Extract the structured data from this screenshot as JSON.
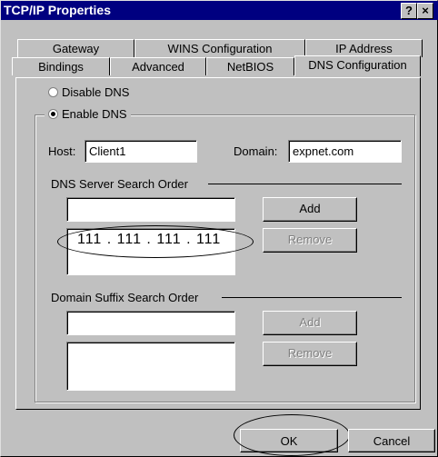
{
  "window": {
    "title": "TCP/IP Properties",
    "help_glyph": "?",
    "close_glyph": "×"
  },
  "tabs": {
    "back_row": [
      "Gateway",
      "WINS Configuration",
      "IP Address"
    ],
    "front_row": [
      "Bindings",
      "Advanced",
      "NetBIOS",
      "DNS Configuration"
    ],
    "active": "DNS Configuration"
  },
  "dns": {
    "disable_label": "Disable DNS",
    "enable_label": "Enable DNS",
    "enabled": true,
    "host_label": "Host:",
    "host_value": "Client1",
    "domain_label": "Domain:",
    "domain_value": "expnet.com"
  },
  "server_order": {
    "heading": "DNS Server Search Order",
    "input_value": "",
    "list_items": [
      "111 . 111 . 111 . 111"
    ],
    "add_label": "Add",
    "remove_label": "Remove"
  },
  "suffix_order": {
    "heading": "Domain Suffix Search Order",
    "input_value": "",
    "add_label": "Add",
    "remove_label": "Remove"
  },
  "footer": {
    "ok_label": "OK",
    "cancel_label": "Cancel"
  }
}
